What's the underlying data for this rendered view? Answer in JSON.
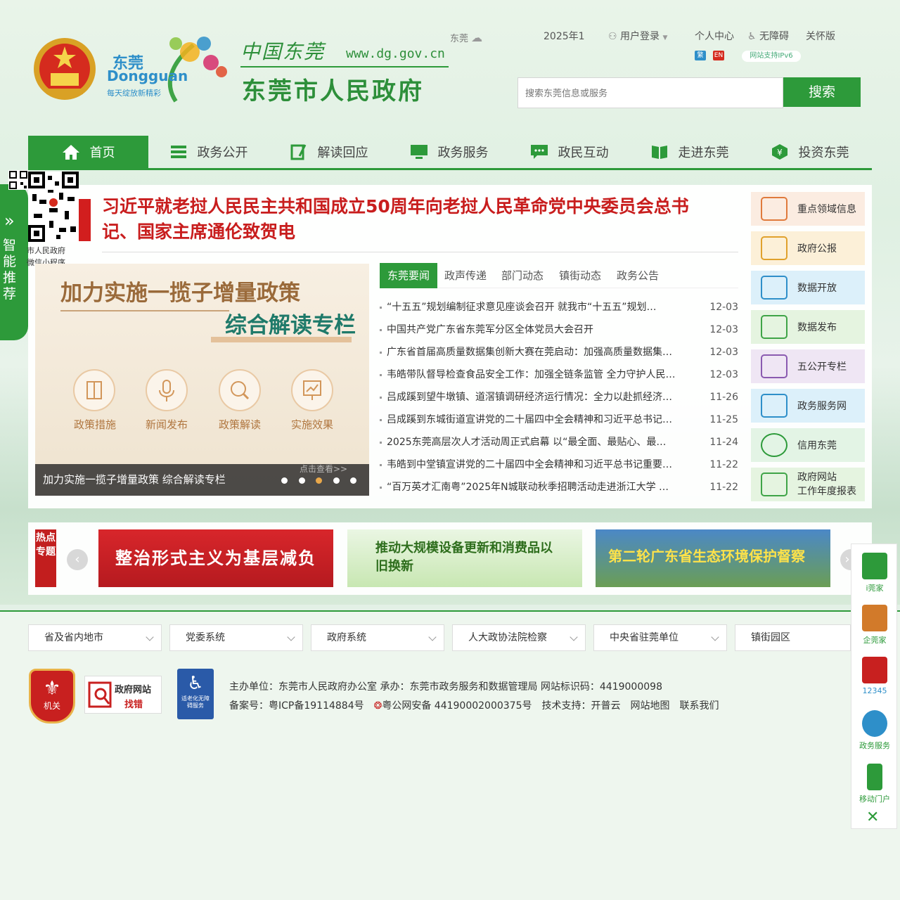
{
  "header": {
    "logo_cn": "东莞",
    "logo_en": "Dongguan",
    "logo_slogan": "每天绽放新精彩",
    "brand": "中国东莞",
    "url": "www.dg.gov.cn",
    "gov_name": "东莞市人民政府",
    "weather_city": "东莞",
    "date": "2025年1",
    "login": "用户登录",
    "personal_center": "个人中心",
    "accessibility": "无障碍",
    "care_mode": "关怀版",
    "lang_trad": "繁",
    "lang_en": "EN",
    "ipv6": "网站支持IPv6",
    "search_placeholder": "搜索东莞信息或服务",
    "search_button": "搜索"
  },
  "nav": [
    {
      "label": "首页"
    },
    {
      "label": "政务公开"
    },
    {
      "label": "解读回应"
    },
    {
      "label": "政务服务"
    },
    {
      "label": "政民互动"
    },
    {
      "label": "走进东莞"
    },
    {
      "label": "投资东莞"
    }
  ],
  "sidebar": {
    "qr_caption_1": "市人民政府",
    "qr_caption_2": "微信小程序",
    "smart_label": "智能推荐",
    "chevron": "»"
  },
  "headline": "习近平就老挝人民民主共和国成立50周年向老挝人民革命党中央委员会总书记、国家主席通伦致贺电",
  "slider": {
    "title_1": "加力实施一揽子增量政策",
    "title_2": "综合解读专栏",
    "icons": [
      {
        "label": "政策措施"
      },
      {
        "label": "新闻发布"
      },
      {
        "label": "政策解读"
      },
      {
        "label": "实施效果"
      }
    ],
    "more": "点击查看>>",
    "caption": "加力实施一揽子增量政策 综合解读专栏",
    "dots": 5,
    "active_dot": 3
  },
  "news": {
    "tabs": [
      {
        "label": "东莞要闻"
      },
      {
        "label": "政声传递"
      },
      {
        "label": "部门动态"
      },
      {
        "label": "镇街动态"
      },
      {
        "label": "政务公告"
      }
    ],
    "items": [
      {
        "title": "“十五五”规划编制征求意见座谈会召开 就我市“十五五”规划…",
        "date": "12-03"
      },
      {
        "title": "中国共产党广东省东莞军分区全体党员大会召开",
        "date": "12-03"
      },
      {
        "title": "广东省首届高质量数据集创新大赛在莞启动：加强高质量数据集…",
        "date": "12-03"
      },
      {
        "title": "韦皓带队督导检查食品安全工作：加强全链条监管 全力守护人民…",
        "date": "12-03"
      },
      {
        "title": "吕成蹊到望牛墩镇、道滘镇调研经济运行情况：全力以赴抓经济…",
        "date": "11-26"
      },
      {
        "title": "吕成蹊到东城街道宣讲党的二十届四中全会精神和习近平总书记…",
        "date": "11-25"
      },
      {
        "title": "2025东莞高层次人才活动周正式启幕 以“最全面、最贴心、最…",
        "date": "11-24"
      },
      {
        "title": "韦皓到中堂镇宣讲党的二十届四中全会精神和习近平总书记重要…",
        "date": "11-22"
      },
      {
        "title": "“百万英才汇南粤”2025年N城联动秋季招聘活动走进浙江大学 …",
        "date": "11-22"
      }
    ]
  },
  "tiles": [
    {
      "label": "重点领域信息",
      "color": "#e07a3c",
      "bg": "#fbece1"
    },
    {
      "label": "政府公报",
      "color": "#e0a12c",
      "bg": "#fcf0d8"
    },
    {
      "label": "数据开放",
      "color": "#2e8fc9",
      "bg": "#dcf0fa"
    },
    {
      "label": "数据发布",
      "color": "#3fa447",
      "bg": "#e5f4e0"
    },
    {
      "label": "五公开专栏",
      "color": "#8a5ab0",
      "bg": "#efe6f4"
    },
    {
      "label": "政务服务网",
      "color": "#2e8fc9",
      "bg": "#dcf0fa"
    },
    {
      "label": "信用东莞",
      "color": "#2d9a3a",
      "bg": "#e3f4e5"
    },
    {
      "label": "政府网站\n工作年度报表",
      "color": "#3fa447",
      "bg": "#e5f4e0"
    }
  ],
  "hot": {
    "label": "热点专题",
    "banners": [
      {
        "text": "整治形式主义为基层减负"
      },
      {
        "text": "推动大规模设备更新和消费品以旧换新"
      },
      {
        "text": "第二轮广东省生态环境保护督察"
      }
    ]
  },
  "footer": {
    "dropdowns": [
      {
        "label": "省及省内地市"
      },
      {
        "label": "党委系统"
      },
      {
        "label": "政府系统"
      },
      {
        "label": "人大政协法院检察"
      },
      {
        "label": "中央省驻莞单位"
      },
      {
        "label": "镇街园区"
      }
    ],
    "badge_jg": "机关",
    "badge_zc_1": "政府网站",
    "badge_zc_2": "找错",
    "badge_wza": "适老化无障碍服务",
    "line1": "主办单位：东莞市人民政府办公室   承办：东莞市政务服务和数据管理局   网站标识码：4419000098",
    "icp": "备案号：粤ICP备19114884号",
    "police": "粤公网安备 44190002000375号",
    "tech": "技术支持：开普云",
    "sitemap": "网站地图",
    "contact": "联系我们"
  },
  "float": [
    {
      "label": "i莞家",
      "color": "#2d9a3a"
    },
    {
      "label": "企莞家",
      "color": "#d27a2a"
    },
    {
      "label": "12345",
      "color": "#c8201f"
    },
    {
      "label": "政务服务",
      "color": "#2e8fc9"
    },
    {
      "label": "移动门户",
      "color": "#2d9a3a"
    }
  ],
  "float_close": "✕"
}
